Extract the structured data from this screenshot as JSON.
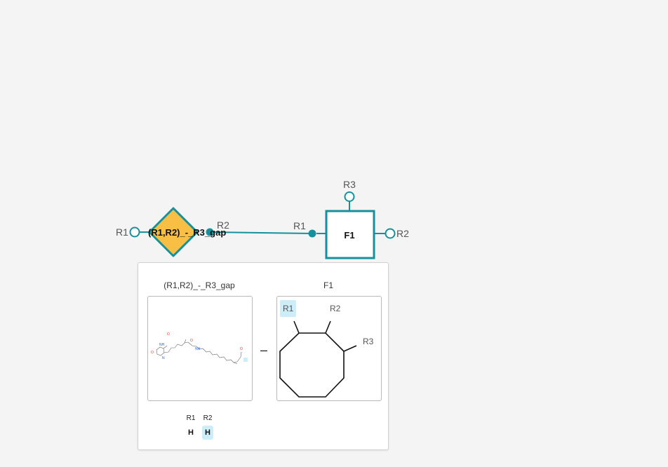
{
  "colors": {
    "teal": "#15919b",
    "diamond": "#f9bf45",
    "highlight": "#cdeef9"
  },
  "diagram": {
    "gap_node": {
      "title": "(R1,R2)_-_R3_gap",
      "left_label": "R1",
      "right_label": "R2"
    },
    "f1_node": {
      "title": "F1",
      "left_label": "R1",
      "top_label": "R3",
      "right_label": "R2"
    }
  },
  "popup": {
    "left_caption": "(R1,R2)_-_R3_gap",
    "right_caption": "F1",
    "operator": "–",
    "ring_labels": [
      "R1",
      "R2",
      "R3"
    ],
    "substituents": [
      {
        "header": "R1",
        "value": "H",
        "highlighted": false
      },
      {
        "header": "R2",
        "value": "H",
        "highlighted": true
      }
    ]
  }
}
